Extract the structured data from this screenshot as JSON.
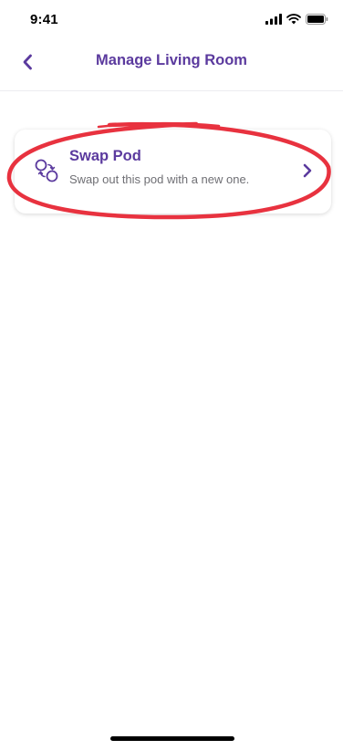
{
  "status_bar": {
    "time": "9:41",
    "icons": [
      "signal-icon",
      "wifi-icon",
      "battery-icon"
    ]
  },
  "header": {
    "title": "Manage Living Room",
    "back_icon": "chevron-left-icon"
  },
  "options": [
    {
      "title": "Swap Pod",
      "subtitle": "Swap out this pod with a new one.",
      "icon": "swap-icon",
      "chevron_icon": "chevron-right-icon"
    }
  ],
  "colors": {
    "accent": "#5b3a9e",
    "annotation": "#e8323f",
    "subtitle_text": "#6f6f74"
  }
}
